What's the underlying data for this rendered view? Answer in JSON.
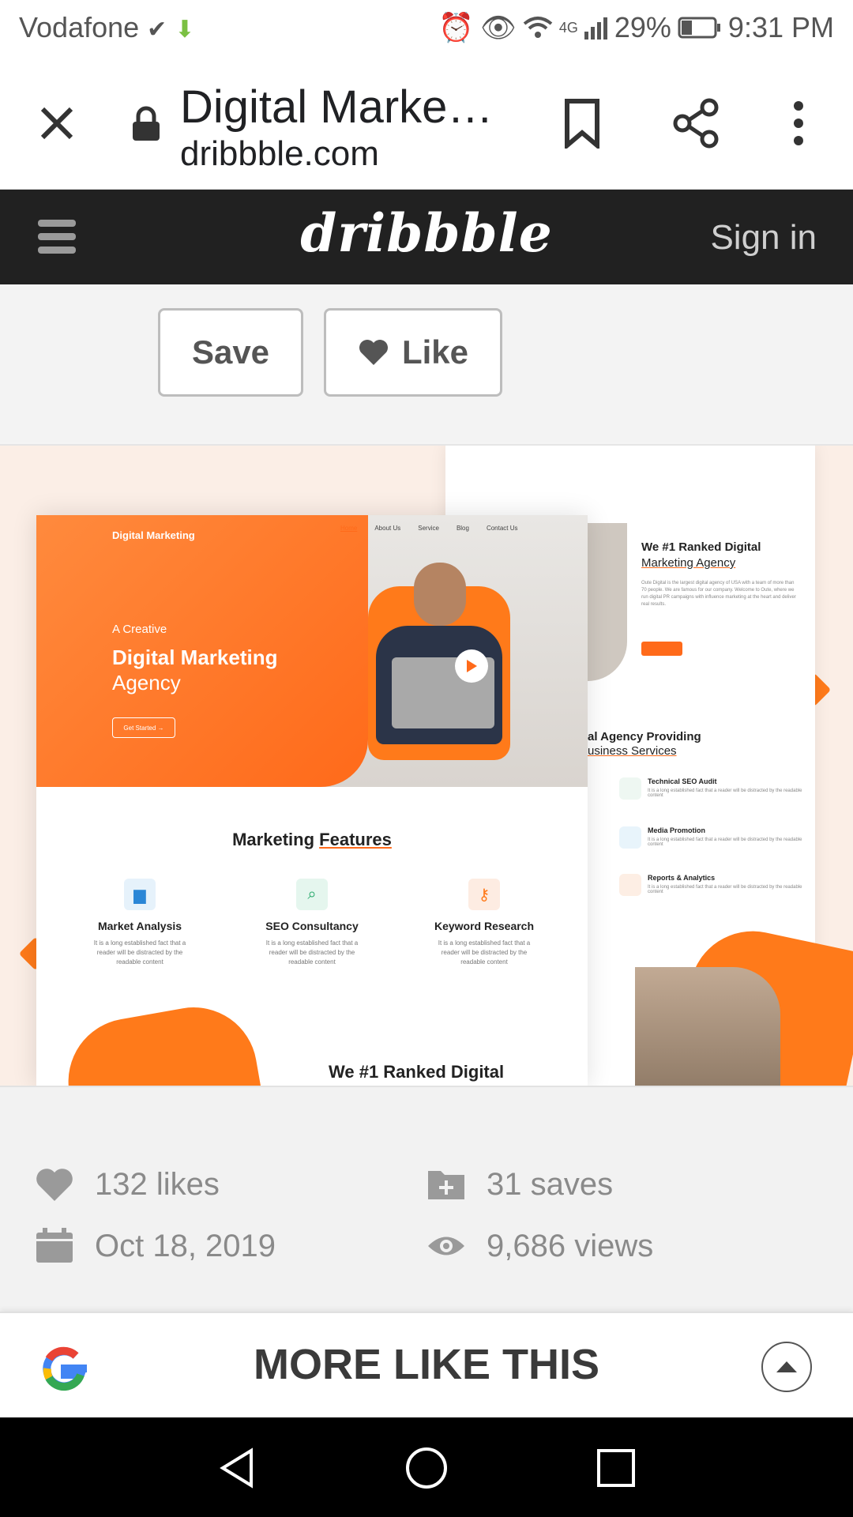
{
  "status_bar": {
    "carrier": "Vodafone",
    "network": "4G",
    "battery": "29%",
    "time": "9:31 PM"
  },
  "browser": {
    "title": "Digital Marke…",
    "domain": "dribbble.com"
  },
  "site_header": {
    "logo": "dribbble",
    "signin_label": "Sign in"
  },
  "actions": {
    "save_label": "Save",
    "like_label": "Like"
  },
  "shot": {
    "hero": {
      "brand": "Digital Marketing",
      "nav": [
        "Home",
        "About Us",
        "Service",
        "Blog",
        "Contact Us"
      ],
      "kicker": "A Creative",
      "title_line1": "Digital Marketing",
      "title_line2": "Agency",
      "cta": "Get Started →"
    },
    "features_title_a": "Marketing",
    "features_title_b": "Features",
    "features": [
      {
        "name": "Market Analysis",
        "desc": "It is a long established fact that a reader will be distracted by the readable content"
      },
      {
        "name": "SEO Consultancy",
        "desc": "It is a long established fact that a reader will be distracted by the readable content"
      },
      {
        "name": "Keyword Research",
        "desc": "It is a long established fact that a reader will be distracted by the readable content"
      }
    ],
    "front_bottom_heading": "We #1 Ranked Digital",
    "back": {
      "heading_line1": "We #1 Ranked Digital",
      "heading_line2": "Marketing Agency",
      "paragraph": "Oute Digital is the largest digital agency of USA with a team of more than 70 people. We are famous for our company. Welcome to Oute, where we run digital PR campaigns with influence marketing at the heart and deliver real results.",
      "section2_line1": "al Agency Providing",
      "section2_line2": "usiness Services",
      "services": [
        {
          "name": "Technical SEO Audit",
          "desc": "It is a long established fact that a reader will be distracted by the readable content"
        },
        {
          "name": "Media Promotion",
          "desc": "It is a long established fact that a reader will be distracted by the readable content"
        },
        {
          "name": "Reports & Analytics",
          "desc": "It is a long established fact that a reader will be distracted by the readable content"
        }
      ]
    }
  },
  "stats": {
    "likes": "132 likes",
    "saves": "31 saves",
    "date": "Oct 18, 2019",
    "views": "9,686 views"
  },
  "more_like_this": {
    "label": "MORE LIKE THIS"
  },
  "colors": {
    "accent": "#ff6a1a",
    "header_bg": "#212121",
    "stat_text": "#8a8a8a"
  }
}
